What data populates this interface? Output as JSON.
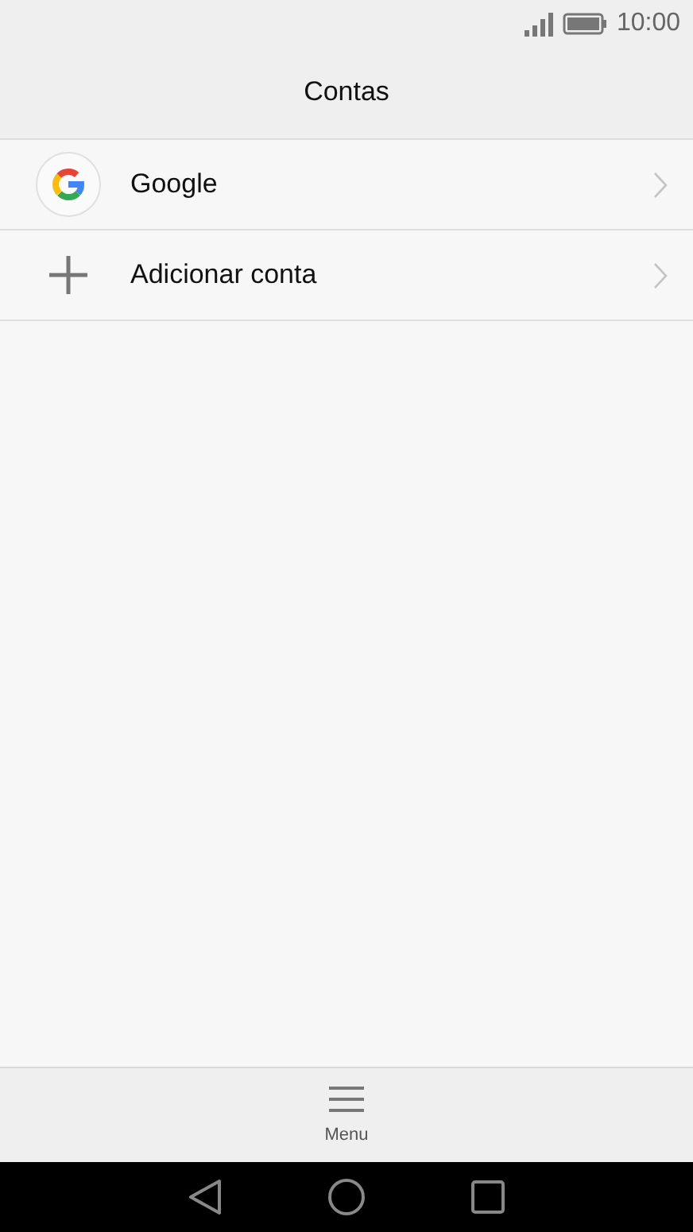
{
  "status_bar": {
    "time": "10:00"
  },
  "header": {
    "title": "Contas"
  },
  "accounts": [
    {
      "kind": "google",
      "label": "Google"
    },
    {
      "kind": "add",
      "label": "Adicionar conta"
    }
  ],
  "bottom_bar": {
    "menu_label": "Menu"
  }
}
